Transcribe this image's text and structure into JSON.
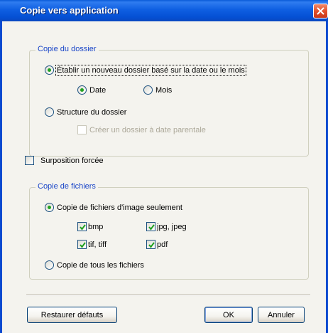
{
  "window": {
    "title": "Copie vers application"
  },
  "folder_group": {
    "legend": "Copie du dossier",
    "option_new_folder": "Établir un nouveau dossier basé sur la date ou le mois",
    "option_date": "Date",
    "option_month": "Mois",
    "option_structure": "Structure du dossier",
    "option_parent_date": "Créer un dossier à date parentale"
  },
  "force_overwrite": {
    "label": "Surposition forcée",
    "checked": false
  },
  "files_group": {
    "legend": "Copie de fichiers",
    "option_images_only": "Copie de fichiers d'image seulement",
    "types": {
      "bmp": "bmp",
      "jpg": "jpg, jpeg",
      "tif": "tif, tiff",
      "pdf": "pdf"
    },
    "option_all_files": "Copie de tous les fichiers"
  },
  "buttons": {
    "restore_defaults": "Restaurer défauts",
    "ok": "OK",
    "cancel": "Annuler"
  },
  "colors": {
    "title_bar": "#0a5cd8",
    "legend_text": "#1a46c8",
    "close_button": "#e2512c",
    "radio_checked": "#21a121",
    "check_mark": "#21a121"
  }
}
